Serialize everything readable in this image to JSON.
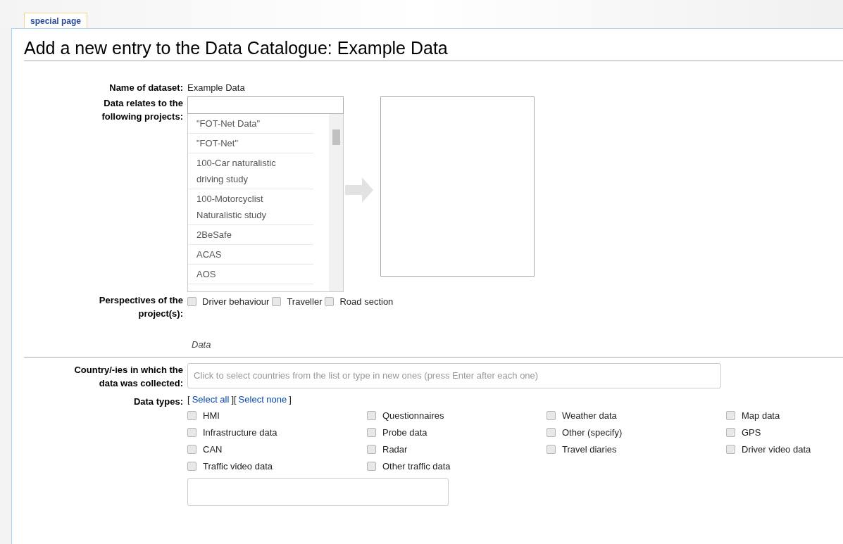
{
  "tab": {
    "label": "special page",
    "selected": true
  },
  "title": "Add a new entry to the Data Catalogue: Example Data",
  "name_field": {
    "label": "Name of dataset:",
    "value": "Example Data"
  },
  "projects": {
    "label": "Data relates to the following projects:",
    "options": [
      "\"FOT-Net Data\"",
      "\"FOT-Net\"",
      "100-Car naturalistic driving study",
      "100-Motorcyclist Naturalistic study",
      "2BeSafe",
      "ACAS",
      "AOS"
    ]
  },
  "perspectives": {
    "label": "Perspectives of the project(s):",
    "options": [
      {
        "label": "Driver behaviour",
        "checked": false
      },
      {
        "label": "Traveller",
        "checked": false
      },
      {
        "label": "Road section",
        "checked": false
      }
    ]
  },
  "section_heading": "Data",
  "countries": {
    "label": "Country/-ies in which the data was collected:",
    "placeholder": "Click to select countries from the list or type in new ones (press Enter after each one)"
  },
  "data_types": {
    "label": "Data types:",
    "links": [
      {
        "kind": "text",
        "text": "["
      },
      {
        "kind": "link",
        "text": "Select all"
      },
      {
        "kind": "text",
        "text": "]["
      },
      {
        "kind": "link",
        "text": "Select none"
      },
      {
        "kind": "text",
        "text": "]"
      }
    ],
    "options": [
      {
        "label": "HMI",
        "checked": false
      },
      {
        "label": "Questionnaires",
        "checked": false
      },
      {
        "label": "Weather data",
        "checked": false
      },
      {
        "label": "Map data",
        "checked": false
      },
      {
        "label": "Infrastructure data",
        "checked": false
      },
      {
        "label": "Probe data",
        "checked": false
      },
      {
        "label": "Other (specify)",
        "checked": false
      },
      {
        "label": "GPS",
        "checked": false
      },
      {
        "label": "CAN",
        "checked": false
      },
      {
        "label": "Radar",
        "checked": false
      },
      {
        "label": "Travel diaries",
        "checked": false
      },
      {
        "label": "Driver video data",
        "checked": false
      },
      {
        "label": "Traffic video data",
        "checked": false
      },
      {
        "label": "Other traffic data",
        "checked": false
      }
    ]
  }
}
